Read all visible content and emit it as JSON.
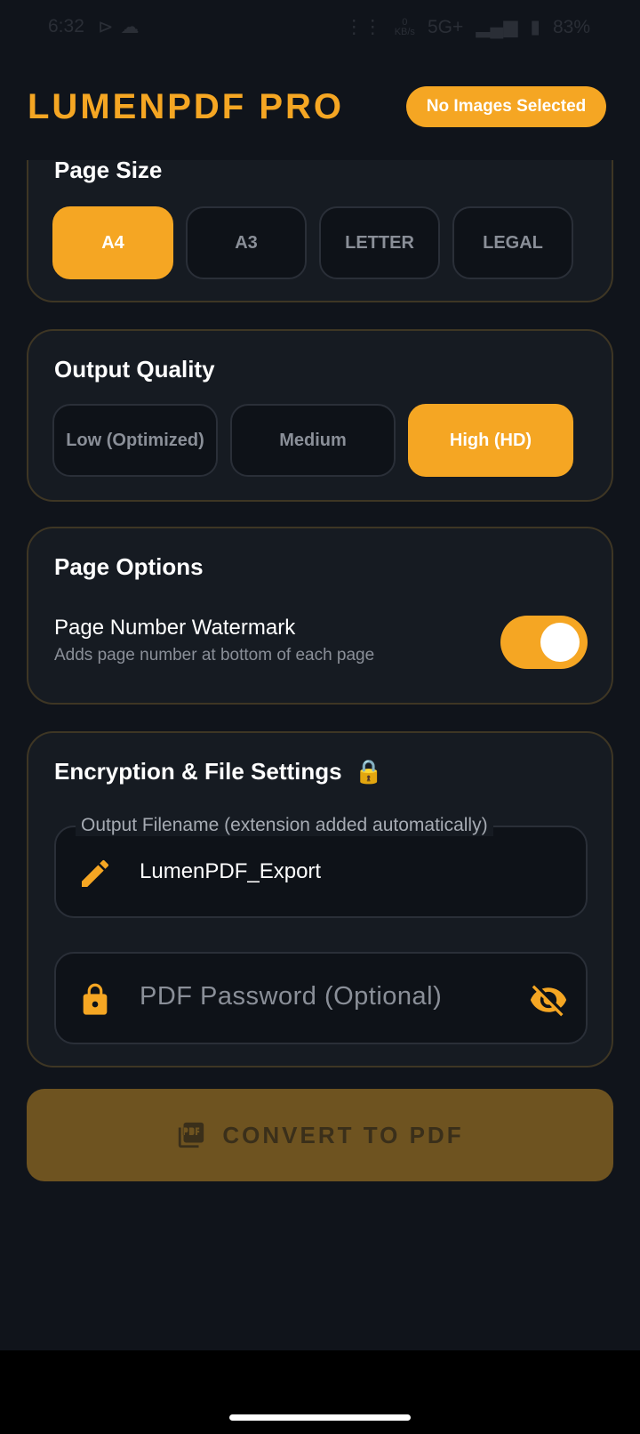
{
  "status_bar": {
    "time": "6:32",
    "signal": "5G+",
    "battery": "83%",
    "speed_unit": "KB/s",
    "speed_value": "0"
  },
  "header": {
    "title": "LUMENPDF PRO",
    "status_pill": "No Images Selected"
  },
  "page_size": {
    "title": "Page Size",
    "options": [
      "A4",
      "A3",
      "LETTER",
      "LEGAL"
    ],
    "selected": "A4"
  },
  "output_quality": {
    "title": "Output Quality",
    "options": [
      "Low (Optimized)",
      "Medium",
      "High (HD)"
    ],
    "selected": "High (HD)"
  },
  "page_options": {
    "title": "Page Options",
    "watermark_label": "Page Number Watermark",
    "watermark_desc": "Adds page number at bottom of each page",
    "watermark_enabled": true
  },
  "encryption": {
    "title": "Encryption & File Settings",
    "title_emoji": "🔒",
    "filename_label": "Output Filename (extension added automatically)",
    "filename_value": "LumenPDF_Export",
    "password_placeholder": "PDF Password (Optional)"
  },
  "convert_button": {
    "label": "CONVERT TO PDF"
  },
  "colors": {
    "accent": "#f5a623",
    "background": "#10141b",
    "card": "#161b22"
  }
}
